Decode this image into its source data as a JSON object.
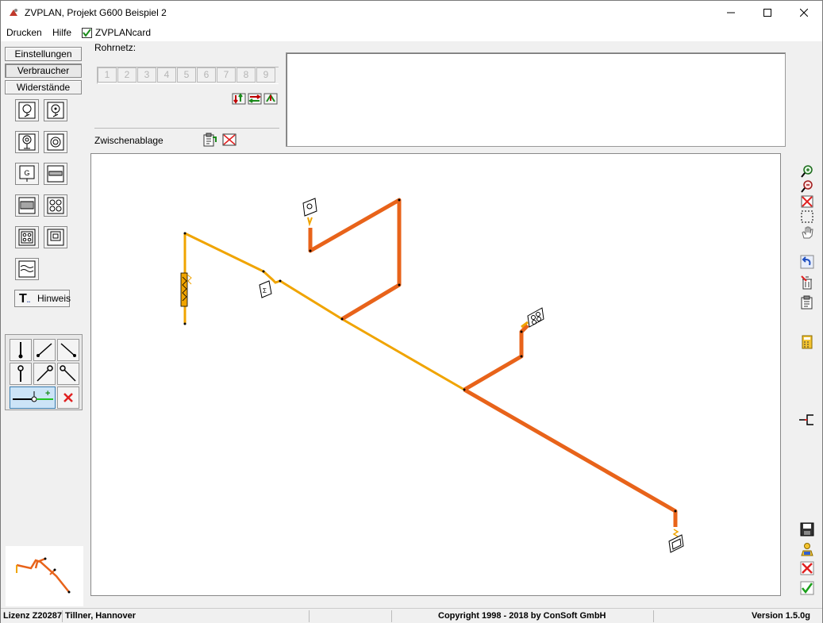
{
  "window": {
    "title": "ZVPLAN, Projekt G600 Beispiel 2"
  },
  "menu": {
    "drucken": "Drucken",
    "hilfe": "Hilfe",
    "zvplancard": "ZVPLANcard",
    "zvplancard_checked": true
  },
  "left": {
    "einstellungen": "Einstellungen",
    "verbraucher": "Verbraucher",
    "widerstaende": "Widerstände",
    "hinweis": "Hinweis"
  },
  "rohrnetz": {
    "label": "Rohrnetz:",
    "tabs": [
      "1",
      "2",
      "3",
      "4",
      "5",
      "6",
      "7",
      "8",
      "9"
    ],
    "zwischenablage": "Zwischenablage"
  },
  "status": {
    "lizenz": "Lizenz Z20287",
    "name": "Tillner, Hannover",
    "copyright": "Copyright 1998 - 2018 by ConSoft GmbH",
    "version": "Version 1.5.0g"
  },
  "colors": {
    "pipe_main": "#e8631a",
    "pipe_yellow": "#f0a400",
    "accent": "#cce4f7"
  }
}
